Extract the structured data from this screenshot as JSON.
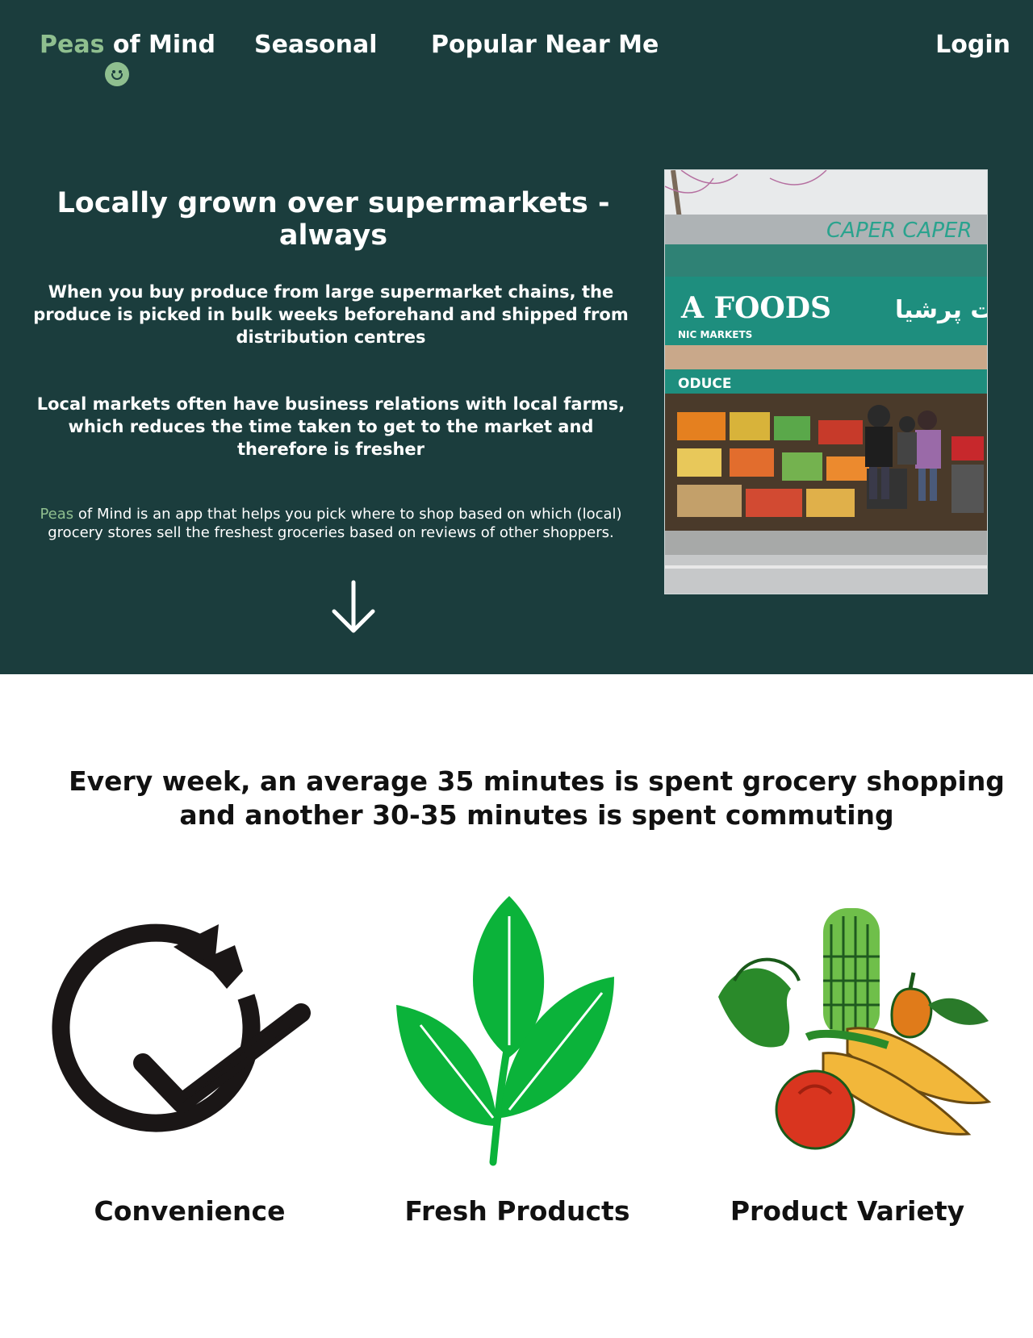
{
  "nav": {
    "brand_peas": "Peas",
    "brand_rest": " of Mind",
    "seasonal": "Seasonal",
    "popular": "Popular Near Me",
    "login": "Login"
  },
  "hero": {
    "title": "Locally grown over supermarkets - always",
    "para1": "When you buy produce from large supermarket chains, the produce is picked in bulk weeks beforehand and shipped from distribution centres",
    "para2": "Local markets often have business relations with local farms, which reduces the time taken to get to the market and therefore is fresher",
    "para3_peas": "Peas",
    "para3_rest": " of Mind is an app that helps you pick where to shop based on which (local) grocery stores sell the freshest groceries based on reviews of other shoppers.",
    "store_sign": "A FOODS",
    "store_sub": "NIC MARKETS",
    "store_produce": "ODUCE",
    "store_persian": "ت پرشیا",
    "store_capers": "CAPER CAPER"
  },
  "stat": {
    "text": "Every week,  an average 35 minutes is spent grocery shopping and another 30-35 minutes is spent commuting"
  },
  "features": [
    {
      "label": "Convenience",
      "icon": "clock-check-icon"
    },
    {
      "label": "Fresh Products",
      "icon": "leaf-icon"
    },
    {
      "label": "Product Variety",
      "icon": "vegetables-icon"
    }
  ],
  "colors": {
    "hero_bg": "#1b3d3d",
    "brand_accent": "#8fbf8f",
    "text_dark": "#111111",
    "leaf_green": "#0bb33a",
    "store_green": "#1e8e7e"
  }
}
